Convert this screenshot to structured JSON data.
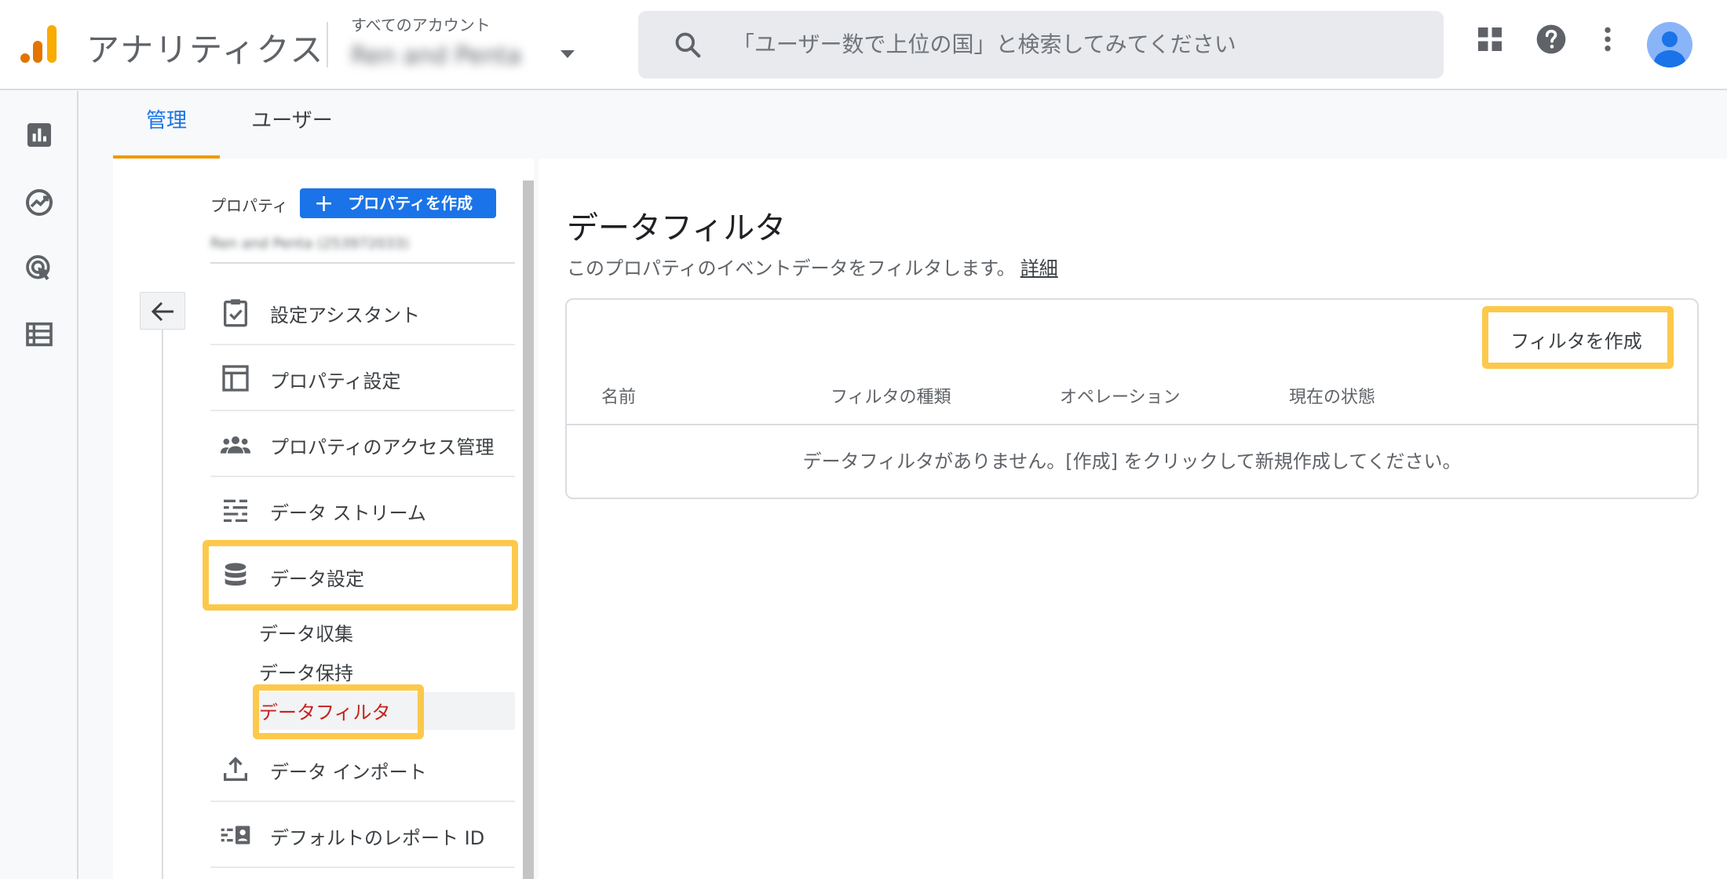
{
  "header": {
    "app_name": "アナリティクス",
    "account_label": "すべてのアカウント",
    "account_name": "Ren and Penta",
    "search_placeholder": "「ユーザー数で上位の国」と検索してみてください"
  },
  "tabs": [
    {
      "label": "管理",
      "active": true
    },
    {
      "label": "ユーザー",
      "active": false
    }
  ],
  "admin": {
    "property_label": "プロパティ",
    "create_property_label": "プロパティを作成",
    "property_name": "Ren and Penta (253972033)",
    "menu": [
      {
        "label": "設定アシスタント",
        "icon": "clipboard-check-icon"
      },
      {
        "label": "プロパティ設定",
        "icon": "layout-icon"
      },
      {
        "label": "プロパティのアクセス管理",
        "icon": "people-icon"
      },
      {
        "label": "データ ストリーム",
        "icon": "streams-icon"
      },
      {
        "label": "データ設定",
        "icon": "database-icon"
      },
      {
        "label": "データ インポート",
        "icon": "upload-icon"
      },
      {
        "label": "デフォルトのレポート ID",
        "icon": "report-id-icon"
      }
    ],
    "data_settings_sub": [
      "データ収集",
      "データ保持",
      "データフィルタ"
    ]
  },
  "main": {
    "title": "データフィルタ",
    "description": "このプロパティのイベントデータをフィルタします。",
    "details_link": "詳細",
    "create_filter_label": "フィルタを作成",
    "columns": [
      "名前",
      "フィルタの種類",
      "オペレーション",
      "現在の状態"
    ],
    "empty_message": "データフィルタがありません。[作成] をクリックして新規作成してください。"
  },
  "colors": {
    "accent": "#1a73e8",
    "tab_underline": "#f29900",
    "active_sub": "#c5221f",
    "highlight": "#fbc02d"
  }
}
